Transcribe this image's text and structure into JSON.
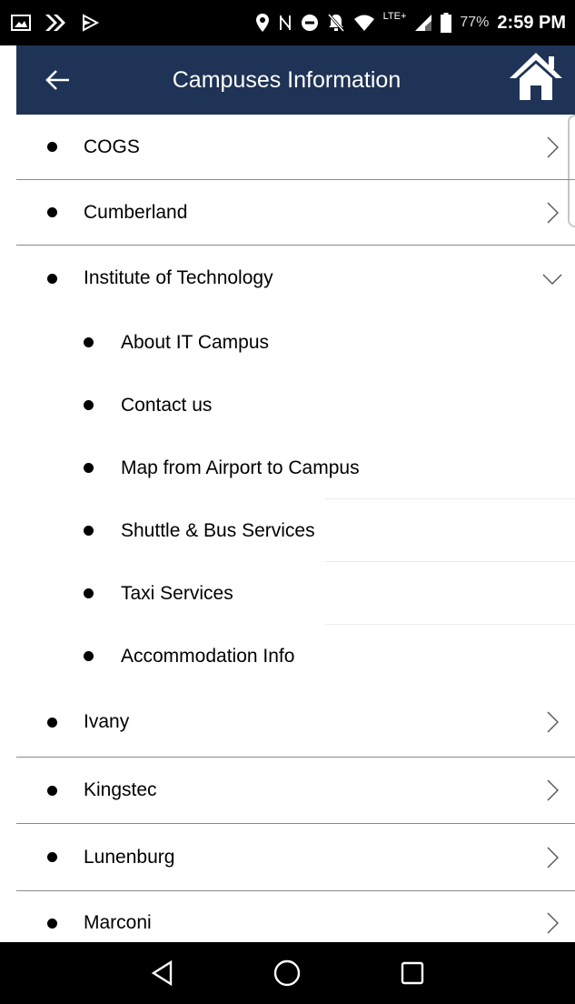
{
  "status_bar": {
    "battery_percent": "77%",
    "time": "2:59 PM",
    "network": "LTE+",
    "icons": [
      "image-icon",
      "next-icon",
      "play-icon",
      "location-pin-icon",
      "nfc-icon",
      "do-not-disturb-icon",
      "notifications-off-icon",
      "wifi-icon",
      "signal-icon",
      "battery-icon"
    ]
  },
  "header": {
    "title": "Campuses Information",
    "back_icon": "arrow-left-icon",
    "home_icon": "home-icon"
  },
  "list": {
    "items": [
      {
        "label": "COGS",
        "expanded": false
      },
      {
        "label": "Cumberland",
        "expanded": false
      },
      {
        "label": "Institute of Technology",
        "expanded": true,
        "subitems": [
          "About IT Campus",
          "Contact us",
          "Map from Airport to Campus",
          "Shuttle & Bus Services",
          "Taxi Services",
          "Accommodation Info"
        ]
      },
      {
        "label": "Ivany",
        "expanded": false
      },
      {
        "label": "Kingstec",
        "expanded": false
      },
      {
        "label": "Lunenburg",
        "expanded": false
      },
      {
        "label": "Marconi",
        "expanded": false
      }
    ]
  },
  "nav_bar": {
    "icons": [
      "back-triangle-icon",
      "home-circle-icon",
      "recents-square-icon"
    ]
  },
  "colors": {
    "header_bg": "#1e3355",
    "status_bar_bg": "#000000",
    "nav_bar_bg": "#000000"
  }
}
